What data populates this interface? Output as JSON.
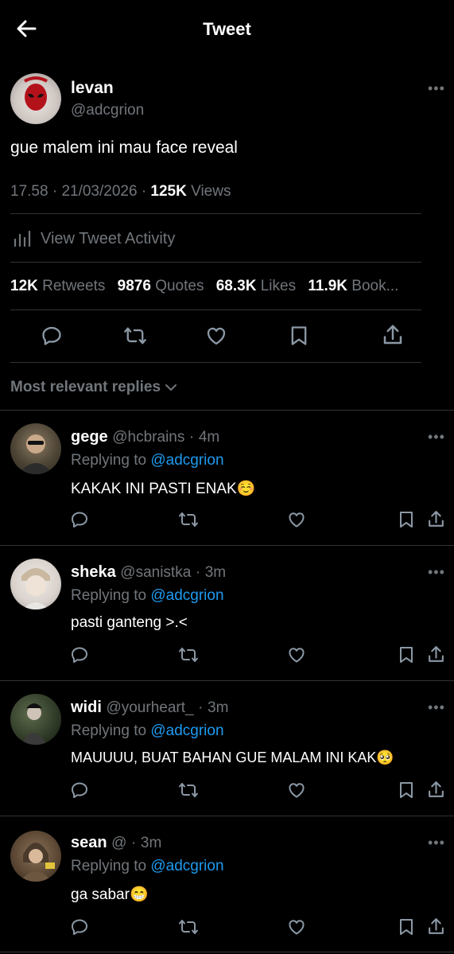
{
  "header": {
    "title": "Tweet"
  },
  "tweet": {
    "name": "levan",
    "handle": "@adcgrion",
    "text": "gue malem ini mau face reveal",
    "time": "17.58",
    "date": "21/03/2026",
    "views_count": "125K",
    "views_label": "Views",
    "activity_label": "View Tweet Activity",
    "stats": {
      "retweets_count": "12K",
      "retweets_label": "Retweets",
      "quotes_count": "9876",
      "quotes_label": "Quotes",
      "likes_count": "68.3K",
      "likes_label": "Likes",
      "bookmarks_count": "11.9K",
      "bookmarks_label": "Book..."
    }
  },
  "replies_header": "Most relevant replies",
  "replies": [
    {
      "name": "gege",
      "handle": "@hcbrains",
      "time": "4m",
      "replying_label": "Replying to",
      "replying_handle": "@adcgrion",
      "text": "KAKAK INI PASTI ENAK☺️"
    },
    {
      "name": "sheka",
      "handle": "@sanistka",
      "time": "3m",
      "replying_label": "Replying to",
      "replying_handle": "@adcgrion",
      "text": "pasti ganteng >.<"
    },
    {
      "name": "widi",
      "handle": "@yourheart_",
      "time": "3m",
      "replying_label": "Replying to",
      "replying_handle": "@adcgrion",
      "text": "MAUUUU, BUAT BAHAN GUE MALAM INI KAK🥺"
    },
    {
      "name": "sean",
      "handle": "@",
      "time": "3m",
      "replying_label": "Replying to",
      "replying_handle": "@adcgrion",
      "text": "ga sabar😁"
    }
  ],
  "separator": "·",
  "colors": {
    "background": "#000000",
    "accent": "#1d9bf0",
    "secondary_text": "#71767b",
    "divider": "#2f3336"
  }
}
